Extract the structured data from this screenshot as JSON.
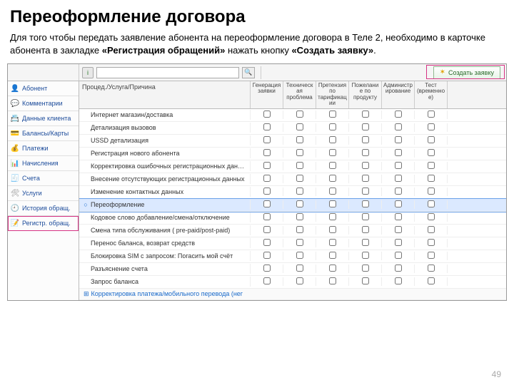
{
  "title": "Переоформление договора",
  "description_pre": "Для того чтобы передать заявление абонента на переоформление договора в Теле 2, необходимо в карточке абонента в закладке ",
  "description_bold1": "«Регистрация обращений»",
  "description_mid": " нажать кнопку ",
  "description_bold2": "«Создать заявку»",
  "description_end": ".",
  "toolbar": {
    "info_btn": "i",
    "search_placeholder": "",
    "create_label": "Создать заявку"
  },
  "sidebar": [
    {
      "icon": "👤",
      "label": "Абонент",
      "color": "#2a7ab8"
    },
    {
      "icon": "💬",
      "label": "Комментарии",
      "color": "#c04040"
    },
    {
      "icon": "📇",
      "label": "Данные клиента",
      "color": "#5a8a3a"
    },
    {
      "icon": "💳",
      "label": "Балансы/Карты",
      "color": "#5a8a3a"
    },
    {
      "icon": "💰",
      "label": "Платежи",
      "color": "#c08a2a"
    },
    {
      "icon": "📊",
      "label": "Начисления",
      "color": "#3a9a6a"
    },
    {
      "icon": "🧾",
      "label": "Счета",
      "color": "#888"
    },
    {
      "icon": "🛠",
      "label": "Услуги",
      "color": "#888"
    },
    {
      "icon": "🕘",
      "label": "История обращ.",
      "color": "#888"
    },
    {
      "icon": "📝",
      "label": "Регистр. обращ.",
      "color": "#c0662a"
    }
  ],
  "grid": {
    "main_header": "Процед./Услуга/Причина",
    "columns": [
      "Генерация заявки",
      "Техническая проблема",
      "Претензия по тарификации",
      "Пожелание по продукту",
      "Администрирование",
      "Тест (временное)"
    ],
    "rows": [
      {
        "label": "Интернет магазин/доставка"
      },
      {
        "label": "Детализация вызовов"
      },
      {
        "label": "USSD детализация"
      },
      {
        "label": "Регистрация нового абонента"
      },
      {
        "label": "Корректировка ошибочных регистрационных данных"
      },
      {
        "label": "Внесение отсутствующих регистрационных данных"
      },
      {
        "label": "Изменение контактных данных"
      },
      {
        "label": "Переоформление",
        "selected": true,
        "mark": "○"
      },
      {
        "label": "Кодовое слово добавление/смена/отключение"
      },
      {
        "label": "Смена типа обслуживания ( pre-paid/post-paid)"
      },
      {
        "label": "Перенос баланса, возврат средств"
      },
      {
        "label": "Блокировка SIM с запросом: Погасить мой счёт"
      },
      {
        "label": "Разъяснение счета"
      },
      {
        "label": "Запрос баланса"
      }
    ],
    "expand_label": "Корректировка платежа/мобильного перевода (нег",
    "expand_mark": "⊞"
  },
  "page_number": "49"
}
